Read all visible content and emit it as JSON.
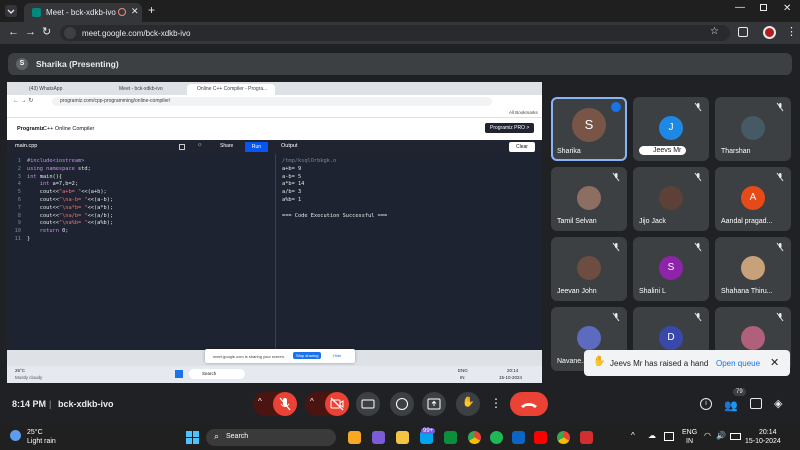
{
  "browser": {
    "tab_title": "Meet - bck-xdkb-ivo",
    "url": "meet.google.com/bck-xdkb-ivo",
    "new_tab": "+"
  },
  "meet": {
    "presenter_initial": "S",
    "presenter_label": "Sharika (Presenting)",
    "meeting_time": "8:14 PM",
    "meeting_sep": "|",
    "meeting_code": "bck-xdkb-ivo",
    "people_count": "79"
  },
  "shared_screen": {
    "tabs": [
      "(43) WhatsApp",
      "Meet - bck-xdkb-ivo",
      "Online C++ Compiler - Progra..."
    ],
    "url": "programiz.com/cpp-programming/online-compiler/",
    "bookmarks": "All Bookmarks",
    "brand": "Programiz",
    "brand_sub": "C++ Online Compiler",
    "pro_button": "Programiz PRO >",
    "file_tab": "main.cpp",
    "share_label": "Share",
    "run_label": "Run",
    "output_label": "Output",
    "clear_label": "Clear",
    "code_lines": [
      {
        "n": "1",
        "html": "<span class='k'>#include&lt;iostream&gt;</span>"
      },
      {
        "n": "2",
        "html": "<span class='k'>using namespace</span> <span class='pl'>std;</span>"
      },
      {
        "n": "3",
        "html": "<span class='k'>int</span> <span class='pl'>main(){</span>"
      },
      {
        "n": "4",
        "html": "    <span class='k'>int</span> <span class='pl'>a=7,b=2;</span>"
      },
      {
        "n": "5",
        "html": "    <span class='pl'>cout&lt;&lt;</span><span class='str'>\"a+b= \"</span><span class='pl'>&lt;&lt;(a+b);</span>"
      },
      {
        "n": "6",
        "html": "    <span class='pl'>cout&lt;&lt;</span><span class='str'>\"\\na-b= \"</span><span class='pl'>&lt;&lt;(a-b);</span>"
      },
      {
        "n": "7",
        "html": "    <span class='pl'>cout&lt;&lt;</span><span class='str'>\"\\na*b= \"</span><span class='pl'>&lt;&lt;(a*b);</span>"
      },
      {
        "n": "8",
        "html": "    <span class='pl'>cout&lt;&lt;</span><span class='str'>\"\\na/b= \"</span><span class='pl'>&lt;&lt;(a/b);</span>"
      },
      {
        "n": "9",
        "html": "    <span class='pl'>cout&lt;&lt;</span><span class='str'>\"\\na%b= \"</span><span class='pl'>&lt;&lt;(a%b);</span>"
      },
      {
        "n": "10",
        "html": "    <span class='k'>return</span> <span class='pl'>0;</span>"
      },
      {
        "n": "11",
        "html": "<span class='pl'>}</span>"
      }
    ],
    "output_lines": [
      "/tmp/ksqlOrbkgk.o",
      "a+b= 9",
      "a-b= 5",
      "a*b= 14",
      "a/b= 3",
      "a%b= 1",
      "",
      "=== Code Execution Successful ==="
    ],
    "sharing_text": "meet.google.com is sharing your screen.",
    "stop_sharing": "Stop sharing",
    "hide": "Hide",
    "weather_temp": "26°C",
    "weather_desc": "Mostly cloudy",
    "search": "Search",
    "lang": "ENG",
    "lang2": "IN",
    "time": "20:14",
    "date": "15-10-2024"
  },
  "participants": [
    {
      "name": "Sharika",
      "initial": "S",
      "color": "#795548",
      "speaking": true
    },
    {
      "name": "Jeevs Mr",
      "initial": "J",
      "color": "#1e88e5"
    },
    {
      "name": "Tharshan",
      "initial": "",
      "color": "#455a64"
    },
    {
      "name": "Tamil Selvan",
      "initial": "",
      "color": "#8d6e63"
    },
    {
      "name": "Jijo Jack",
      "initial": "",
      "color": "#5d4037"
    },
    {
      "name": "Aandal pragad...",
      "initial": "A",
      "color": "#e64a19"
    },
    {
      "name": "Jeevan John",
      "initial": "",
      "color": "#6d4c41"
    },
    {
      "name": "Shalini L",
      "initial": "S",
      "color": "#8e24aa"
    },
    {
      "name": "Shahana Thiru...",
      "initial": "",
      "color": "#c7a17a"
    },
    {
      "name": "Navane...",
      "initial": "",
      "color": "#5c6bc0"
    },
    {
      "name": "",
      "initial": "D",
      "color": "#3949ab"
    },
    {
      "name": "",
      "initial": "",
      "color": "#b0607a"
    }
  ],
  "toast": {
    "text": "Jeevs Mr has raised a hand",
    "action": "Open queue"
  },
  "taskbar": {
    "weather_temp": "25°C",
    "weather_desc": "Light rain",
    "search": "Search",
    "lang": "ENG",
    "lang2": "IN",
    "time": "20:14",
    "date": "15-10-2024",
    "badge": "99+"
  }
}
